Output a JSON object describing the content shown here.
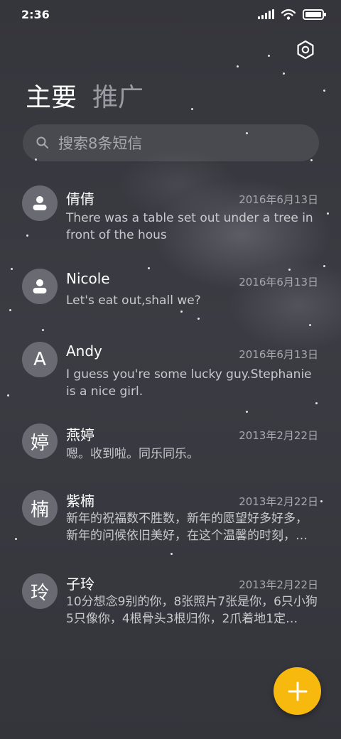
{
  "status_bar": {
    "time": "2:36",
    "icons": [
      "signal-icon",
      "wifi-icon",
      "battery-icon"
    ]
  },
  "header": {
    "settings_icon": "settings-hexagon-icon",
    "tabs": [
      {
        "label": "主要",
        "active": true
      },
      {
        "label": "推广",
        "active": false
      }
    ]
  },
  "search": {
    "placeholder": "搜索8条短信",
    "icon": "search-icon"
  },
  "conversations": [
    {
      "avatar": "person-icon",
      "name": "倩倩",
      "date": "2016年6月13日",
      "preview": "There was a table set out under a tree in front of the hous"
    },
    {
      "avatar": "person-icon",
      "name": "Nicole",
      "date": "2016年6月13日",
      "preview": "Let's eat out,shall we?"
    },
    {
      "avatar_text": "A",
      "name": "Andy",
      "date": "2016年6月13日",
      "preview": "I guess you're some lucky guy.Stephanie is a nice girl."
    },
    {
      "avatar_text": "婷",
      "name": "燕婷",
      "date": "2013年2月22日",
      "preview": "嗯。收到啦。同乐同乐。"
    },
    {
      "avatar_text": "楠",
      "name": "紫楠",
      "date": "2013年2月22日",
      "preview": "新年的祝福数不胜数，新年的愿望好多好多，新年的问候依旧美好，在这个温馨的时刻，…"
    },
    {
      "avatar_text": "玲",
      "name": "子玲",
      "date": "2013年2月22日",
      "preview": "10分想念9别的你，8张照片7张是你，6只小狗5只像你，4根骨头3根归你，2爪着地1定…"
    }
  ],
  "fab": {
    "icon": "plus-icon"
  },
  "colors": {
    "background": "#3a3b42",
    "accent": "#f7b90e",
    "avatar": "#6a6b72",
    "muted_text": "#a8a9ae"
  }
}
